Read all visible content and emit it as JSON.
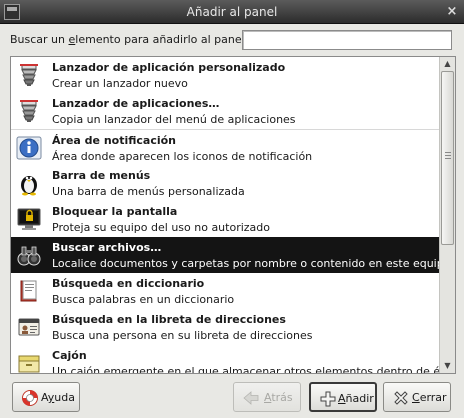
{
  "window": {
    "title": "Añadir al panel",
    "close_glyph": "×"
  },
  "search": {
    "label_before": "Buscar un ",
    "label_mnemonic": "e",
    "label_after": "lemento para añadirlo al panel:",
    "value": ""
  },
  "items": [
    {
      "name": "Lanzador de aplicación personalizado",
      "desc": "Crear un lanzador nuevo",
      "icon": "launcher-icon",
      "selected": false
    },
    {
      "name": "Lanzador de aplicaciones…",
      "desc": "Copia un lanzador del menú de aplicaciones",
      "icon": "launcher-icon",
      "selected": false
    },
    {
      "name": "Área de notificación",
      "desc": "Área donde aparecen los iconos de notificación",
      "icon": "info-icon",
      "selected": false
    },
    {
      "name": "Barra de menús",
      "desc": "Una barra de menús personalizada",
      "icon": "penguin-icon",
      "selected": false
    },
    {
      "name": "Bloquear la pantalla",
      "desc": "Proteja su equipo del uso no autorizado",
      "icon": "lock-screen-icon",
      "selected": false
    },
    {
      "name": "Buscar archivos…",
      "desc": "Localice documentos y carpetas por nombre o contenido en este equipo",
      "icon": "binoculars-icon",
      "selected": true
    },
    {
      "name": "Búsqueda en diccionario",
      "desc": "Busca palabras en un diccionario",
      "icon": "dictionary-icon",
      "selected": false
    },
    {
      "name": "Búsqueda en la libreta de direcciones",
      "desc": "Busca una persona en su libreta de direcciones",
      "icon": "address-book-icon",
      "selected": false
    },
    {
      "name": "Cajón",
      "desc": "Un cajón emergente en el que almacenar otros elementos dentro de él",
      "icon": "drawer-icon",
      "selected": false
    }
  ],
  "buttons": {
    "help": {
      "pre": "A",
      "mn": "y",
      "post": "uda",
      "icon": "lifebuoy-icon"
    },
    "back": {
      "pre": "",
      "mn": "A",
      "post": "trás",
      "icon": "back-arrow-icon",
      "disabled": true
    },
    "add": {
      "pre": "",
      "mn": "A",
      "post": "ñadir",
      "icon": "plus-icon"
    },
    "close": {
      "pre": "",
      "mn": "C",
      "post": "errar",
      "icon": "close-x-icon"
    }
  }
}
